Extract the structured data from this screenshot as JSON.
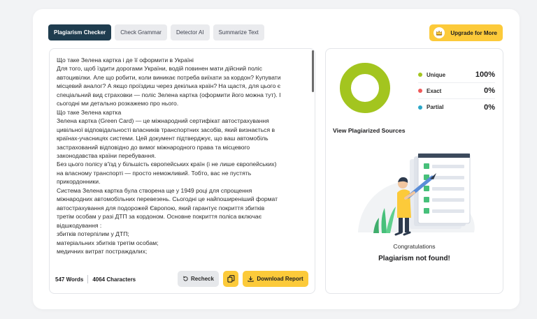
{
  "tabs": [
    {
      "label": "Plagiarism Checker",
      "active": true
    },
    {
      "label": "Check Grammar",
      "active": false
    },
    {
      "label": "Detector AI",
      "active": false
    },
    {
      "label": "Summarize Text",
      "active": false
    }
  ],
  "upgrade": {
    "label": "Upgrade for More",
    "icon": "crown-icon"
  },
  "editor": {
    "lines": [
      "Що таке Зелена картка і де її оформити в Україні",
      "Для того, щоб їздити дорогами України, водій повинен мати дійсний поліс",
      "автоцивілки. Але що робити, коли виникає потреба виїхати за кордон? Купувати",
      "місцевий аналог? А якщо проїздиш через декілька країн? На щастя, для цього є",
      "спеціальний вид страховки — поліс Зелена картка (оформити його можна тут). І",
      "сьогодні ми детально розкажемо про нього.",
      "Що таке Зелена картка",
      "Зелена картка (Green Card) — це міжнародний сертифікат автострахування",
      "цивільної відповідальності власників транспортних засобів, який визнається в",
      "країнах-учасницях системи. Цей документ підтверджує, що ваш автомобіль",
      "застрахований відповідно до вимог міжнародного права та місцевого",
      "законодавства країни перебування.",
      "Без цього полісу в'їзд у більшість європейських країн (і не лише європейських)",
      "на власному транспорті — просто неможливий. Тобто, вас не пустять",
      "прикордонники.",
      "Система Зелена картка була створена ще у 1949 році для спрощення",
      "міжнародних автомобільних перевезень. Сьогодні це найпоширеніший формат",
      "автострахування для подорожей Європою, який гарантує покриття збитків",
      "третім особам у разі ДТП за кордоном. Основне покриття поліса включає",
      "відшкодування :",
      "збитків потерпілим у ДТП;",
      "матеріальних збитків третім особам;",
      "медичних витрат постраждалих;"
    ],
    "words": "547 Words",
    "characters": "4064 Characters",
    "recheck_label": "Recheck",
    "download_label": "Download Report"
  },
  "results": {
    "legend": [
      {
        "label": "Unique",
        "value": "100%",
        "fraction": 1.0,
        "color": "#a3c51f"
      },
      {
        "label": "Exact",
        "value": "0%",
        "fraction": 0.0,
        "color": "#ef5a5a"
      },
      {
        "label": "Partial",
        "value": "0%",
        "fraction": 0.0,
        "color": "#2ba7c8"
      }
    ],
    "sources_title": "View Plagiarized Sources",
    "congrats": "Congratulations",
    "not_found": "Plagiarism not found!"
  },
  "colors": {
    "accent": "#fcca3a",
    "dark_tab": "#1f3d4f",
    "unique": "#a3c51f"
  }
}
